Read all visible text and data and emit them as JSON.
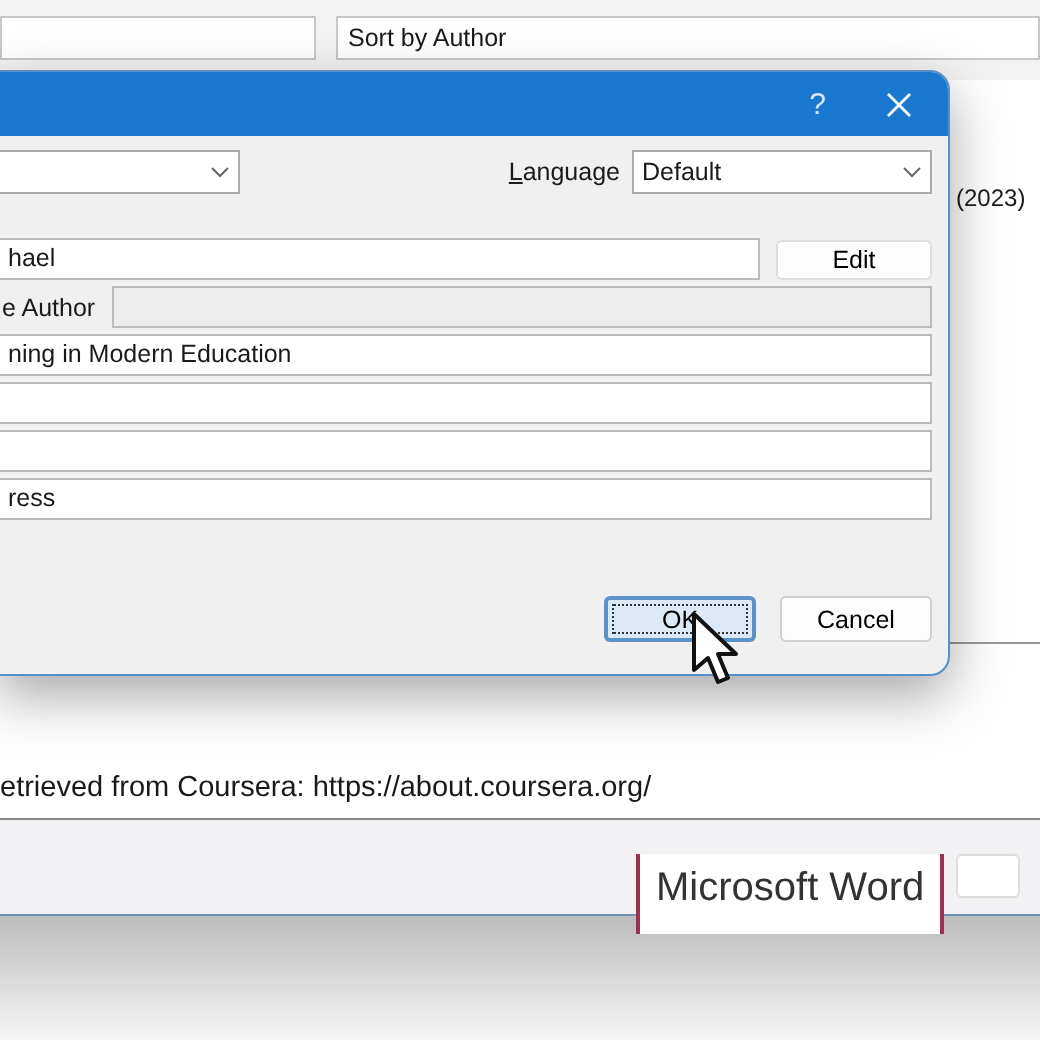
{
  "background": {
    "sort_field": {
      "value": "Sort by Author"
    },
    "year_text": "(2023)",
    "reference_text": "etrieved from Coursera: https://about.coursera.org/",
    "caption": "Microsoft Word"
  },
  "dialog": {
    "help": "?",
    "language": {
      "label": "Language",
      "value": "Default"
    },
    "rows": [
      {
        "kind": "field_button",
        "value": "hael",
        "button": "Edit"
      },
      {
        "kind": "labeled",
        "label": "e Author",
        "disabled": true
      },
      {
        "kind": "field",
        "value": "ning in Modern Education"
      },
      {
        "kind": "field"
      },
      {
        "kind": "field"
      },
      {
        "kind": "field",
        "value": "ress"
      }
    ],
    "buttons": [
      {
        "label": "OK",
        "default": true
      },
      {
        "label": "Cancel",
        "default": false
      }
    ]
  }
}
